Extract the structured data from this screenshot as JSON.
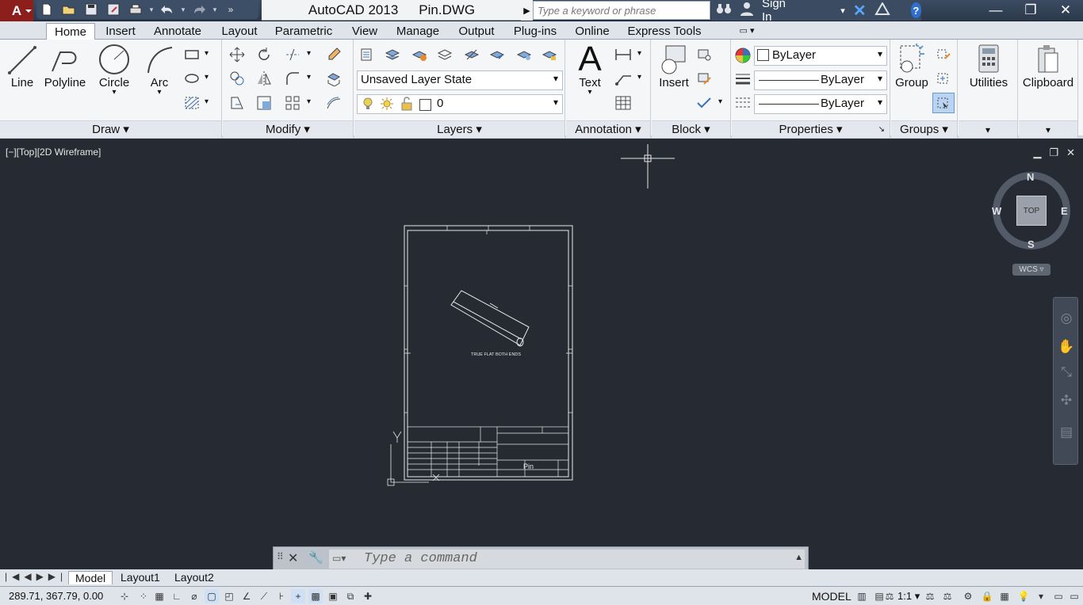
{
  "app": {
    "name": "AutoCAD 2013",
    "file": "Pin.DWG"
  },
  "search": {
    "placeholder": "Type a keyword or phrase"
  },
  "account": {
    "sign_in": "Sign In"
  },
  "tabs": [
    "Home",
    "Insert",
    "Annotate",
    "Layout",
    "Parametric",
    "View",
    "Manage",
    "Output",
    "Plug-ins",
    "Online",
    "Express Tools"
  ],
  "active_tab": "Home",
  "draw": {
    "title": "Draw",
    "line": "Line",
    "polyline": "Polyline",
    "circle": "Circle",
    "arc": "Arc"
  },
  "modify": {
    "title": "Modify"
  },
  "layers": {
    "title": "Layers",
    "state": "Unsaved Layer State",
    "current": "0"
  },
  "annotation": {
    "title": "Annotation",
    "text": "Text"
  },
  "block": {
    "title": "Block",
    "insert": "Insert"
  },
  "properties": {
    "title": "Properties",
    "color": "ByLayer",
    "linetype": "ByLayer",
    "lineweight": "ByLayer"
  },
  "groups": {
    "title": "Groups",
    "group": "Group"
  },
  "utilities": {
    "label": "Utilities"
  },
  "clipboard": {
    "label": "Clipboard"
  },
  "viewport": {
    "label": "[−][Top][2D Wireframe]",
    "cube_top": "TOP",
    "north": "N",
    "south": "S",
    "east": "E",
    "west": "W",
    "wcs": "WCS"
  },
  "drawing": {
    "part_note": "TRUE FLAT BOTH ENDS",
    "title_block_name": "Pin"
  },
  "command": {
    "placeholder": "Type a command"
  },
  "layout_tabs": [
    "Model",
    "Layout1",
    "Layout2"
  ],
  "status": {
    "coords": "289.71, 367.79, 0.00",
    "space": "MODEL",
    "scale": "1:1"
  }
}
